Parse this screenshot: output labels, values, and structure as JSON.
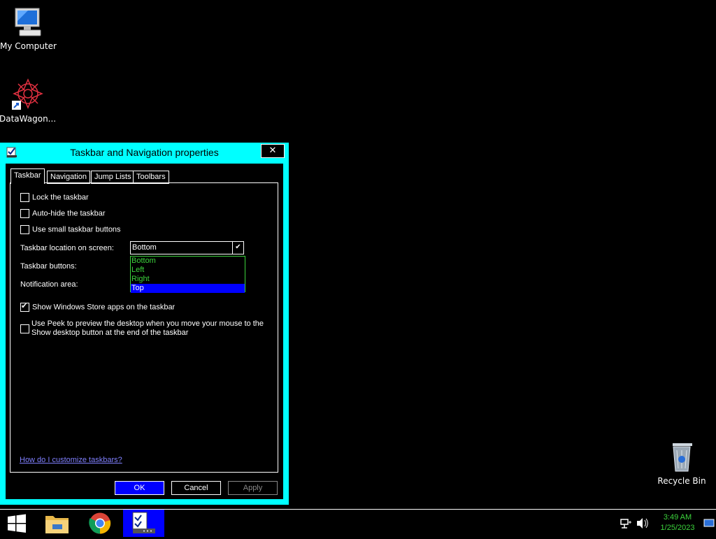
{
  "desktop": {
    "icons": [
      {
        "label": "My Computer",
        "icon": "computer-icon"
      },
      {
        "label": "DataWagon...",
        "icon": "datawagon-shortcut-icon"
      },
      {
        "label": "Recycle Bin",
        "icon": "recycle-bin-icon"
      }
    ]
  },
  "dialog": {
    "title": "Taskbar and Navigation properties",
    "close_label": "✕",
    "tabs": [
      {
        "label": "Taskbar",
        "active": true
      },
      {
        "label": "Navigation",
        "active": false
      },
      {
        "label": "Jump Lists",
        "active": false
      },
      {
        "label": "Toolbars",
        "active": false
      }
    ],
    "checkboxes": {
      "lock": {
        "label": "Lock the taskbar",
        "checked": false
      },
      "autohide": {
        "label": "Auto-hide the taskbar",
        "checked": false
      },
      "small": {
        "label": "Use small taskbar buttons",
        "checked": false
      },
      "store": {
        "label": "Show Windows Store apps on the taskbar",
        "checked": true
      },
      "peek": {
        "label_line1": "Use Peek to preview the desktop when you move your mouse to the",
        "label_line2": "Show desktop button at the end of the taskbar",
        "checked": false
      }
    },
    "location_label": "Taskbar location on screen:",
    "location_value": "Bottom",
    "location_options": [
      "Bottom",
      "Left",
      "Right",
      "Top"
    ],
    "location_highlighted": "Top",
    "buttons_label": "Taskbar buttons:",
    "notification_label": "Notification area:",
    "help_link": "How do I customize taskbars?",
    "ok_label": "OK",
    "cancel_label": "Cancel",
    "apply_label": "Apply"
  },
  "taskbar": {
    "items": [
      "start-icon",
      "file-explorer-icon",
      "chrome-icon",
      "taskbar-properties-icon"
    ],
    "time": "3:49 AM",
    "date": "1/25/2023"
  },
  "colors": {
    "dialog_frame": "#00ffff",
    "accent_blue": "#0000ff",
    "text_green": "#3cd43c"
  }
}
